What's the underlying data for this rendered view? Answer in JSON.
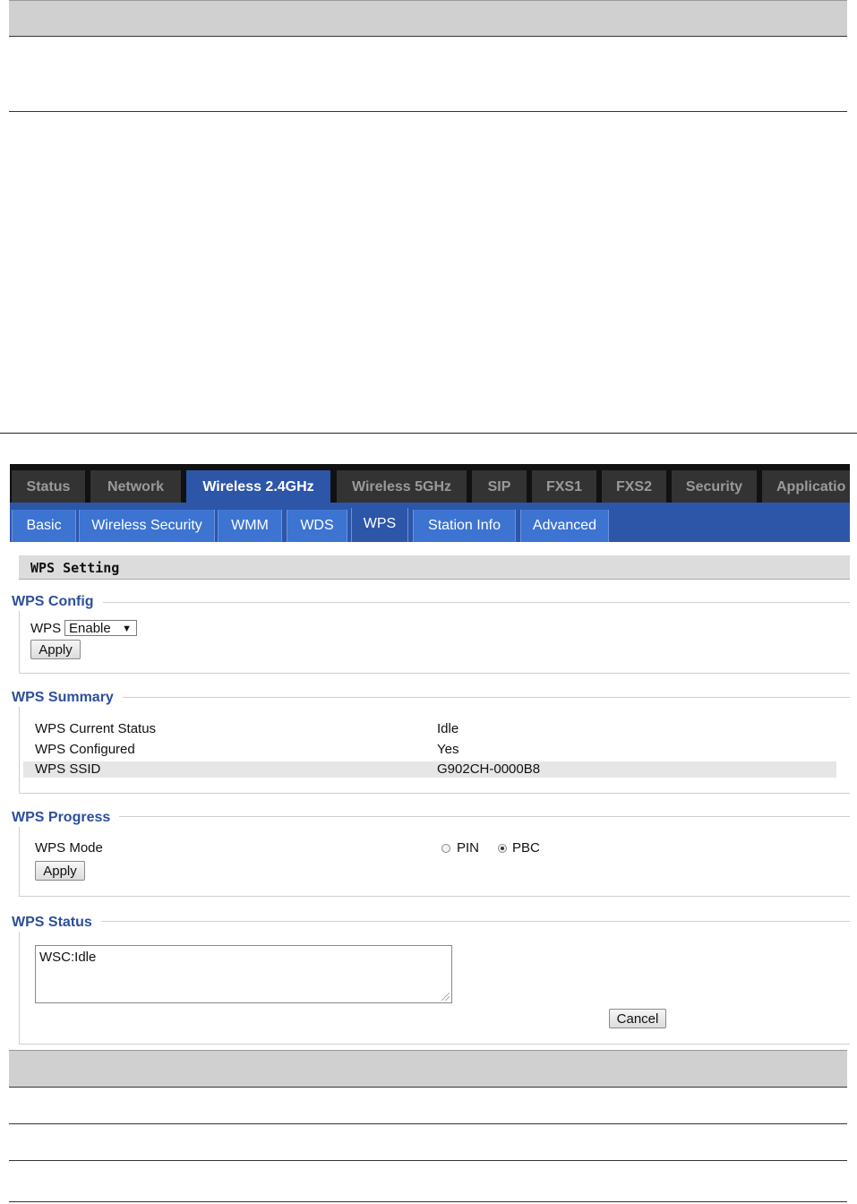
{
  "main_tabs": [
    "Status",
    "Network",
    "Wireless 2.4GHz",
    "Wireless 5GHz",
    "SIP",
    "FXS1",
    "FXS2",
    "Security",
    "Applicatio"
  ],
  "main_tab_active": "Wireless 2.4GHz",
  "sub_tabs": [
    "Basic",
    "Wireless Security",
    "WMM",
    "WDS",
    "WPS",
    "Station Info",
    "Advanced"
  ],
  "sub_tab_active": "WPS",
  "section_title": "WPS Setting",
  "wps_config": {
    "legend": "WPS Config",
    "label": "WPS",
    "select_value": "Enable",
    "apply_label": "Apply"
  },
  "wps_summary": {
    "legend": "WPS Summary",
    "rows": [
      {
        "key": "WPS Current Status",
        "value": "Idle"
      },
      {
        "key": "WPS Configured",
        "value": "Yes"
      },
      {
        "key": "WPS SSID",
        "value": "G902CH-0000B8"
      }
    ]
  },
  "wps_progress": {
    "legend": "WPS Progress",
    "label": "WPS Mode",
    "option_pin": "PIN",
    "option_pbc": "PBC",
    "selected": "PBC",
    "apply_label": "Apply"
  },
  "wps_status": {
    "legend": "WPS Status",
    "text": "WSC:Idle",
    "cancel_label": "Cancel"
  },
  "colors": {
    "tab_active": "#2d56a8",
    "subtab": "#3d74d2",
    "legend": "#2d4f9a"
  }
}
